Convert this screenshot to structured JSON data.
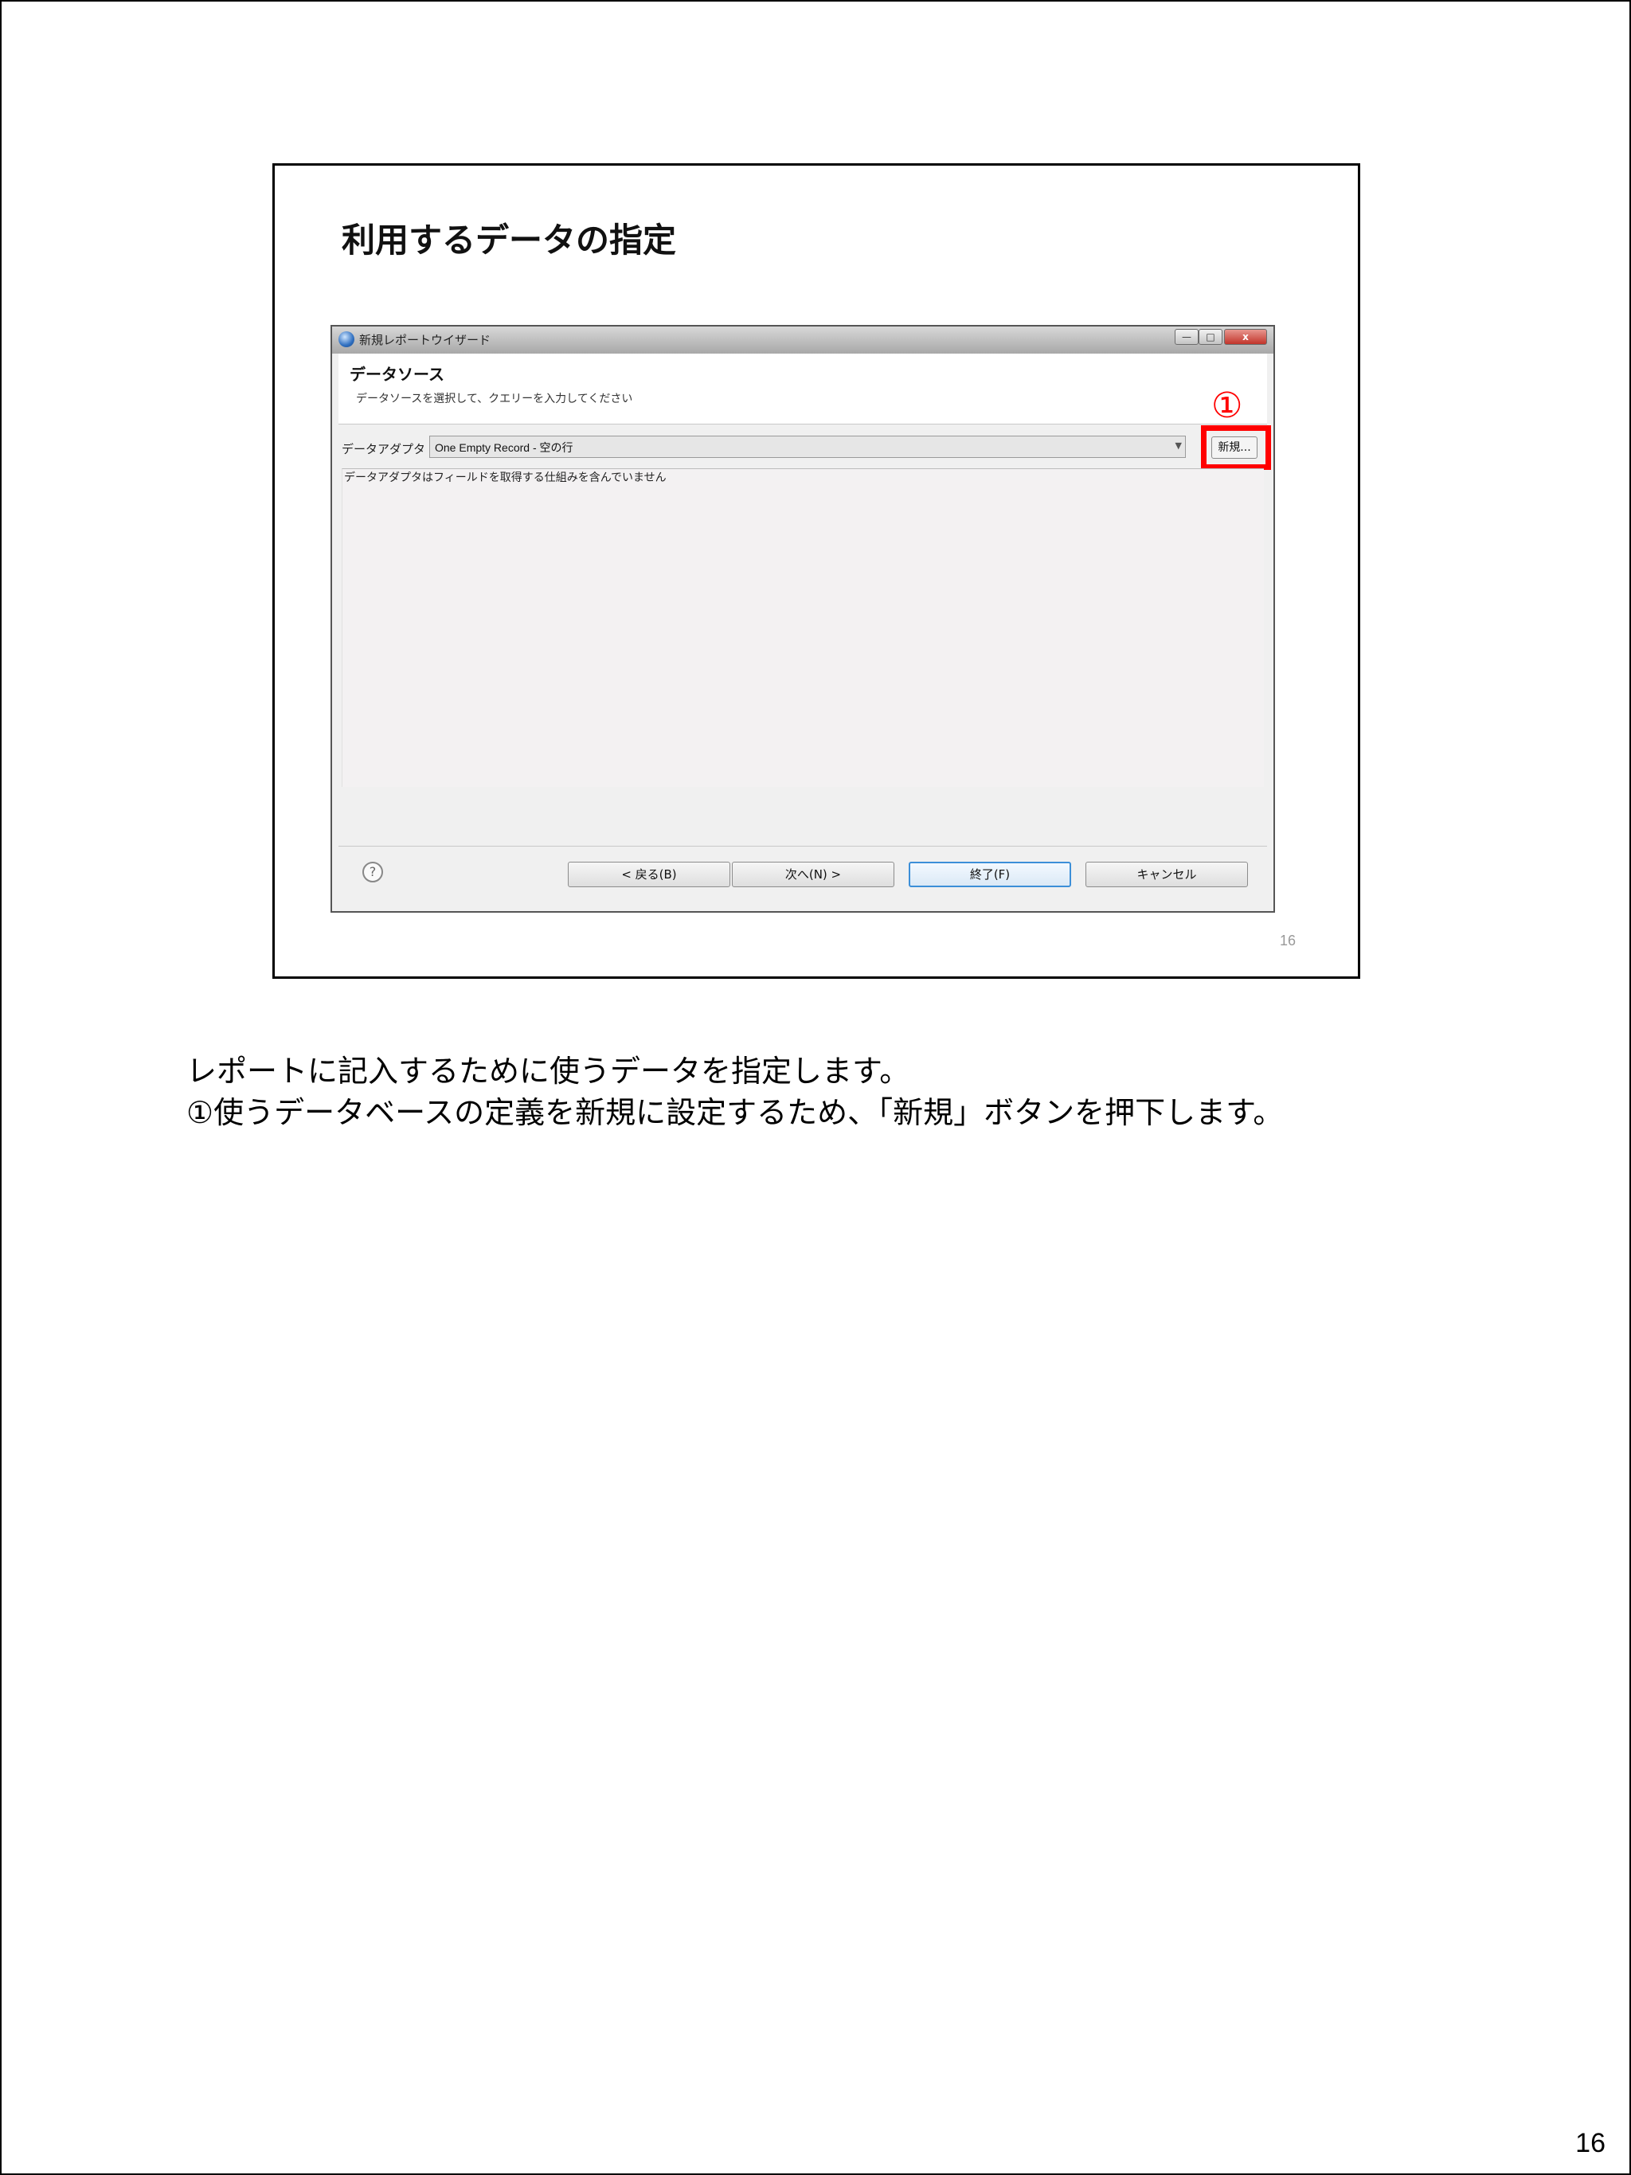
{
  "slide": {
    "title": "利用するデータの指定",
    "number": "16"
  },
  "dialog": {
    "window_title": "新規レポートウイザード",
    "window_buttons": {
      "minimize": "—",
      "maximize": "□",
      "close": "x"
    },
    "header_title": "データソース",
    "header_desc": "データソースを選択して、クエリーを入力してください",
    "adapter_label": "データアダプタ",
    "adapter_value": "One Empty Record - 空の行",
    "new_button": "新規...",
    "content_message": "データアダプタはフィールドを取得する仕組みを含んでいません",
    "help_symbol": "?",
    "buttons": {
      "back": "< 戻る(B)",
      "next": "次へ(N) >",
      "finish": "終了(F)",
      "cancel": "キャンセル"
    }
  },
  "annotation": {
    "marker": "①",
    "color": "#ff0000"
  },
  "narration": {
    "line1": "レポートに記入するために使うデータを指定します。",
    "line2": "①使うデータベースの定義を新規に設定するため、「新規」ボタンを押下します。"
  },
  "page_number": "16"
}
